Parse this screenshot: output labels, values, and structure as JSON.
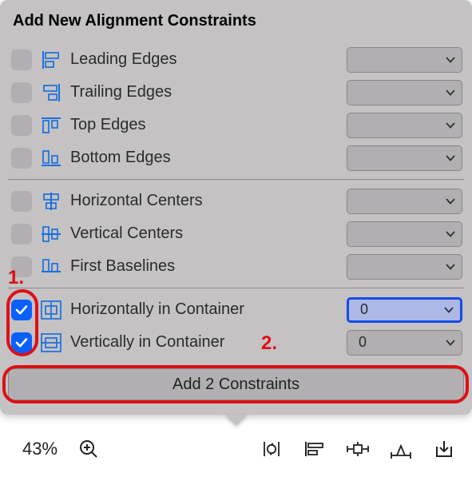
{
  "panelTitle": "Add New Alignment Constraints",
  "groups": [
    {
      "rows": [
        {
          "id": "leading",
          "checked": false,
          "iconKey": "align-leading",
          "label": "Leading Edges",
          "value": "",
          "highlighted": false
        },
        {
          "id": "trailing",
          "checked": false,
          "iconKey": "align-trailing",
          "label": "Trailing Edges",
          "value": "",
          "highlighted": false
        },
        {
          "id": "top",
          "checked": false,
          "iconKey": "align-top",
          "label": "Top Edges",
          "value": "",
          "highlighted": false
        },
        {
          "id": "bottom",
          "checked": false,
          "iconKey": "align-bottom",
          "label": "Bottom Edges",
          "value": "",
          "highlighted": false
        }
      ]
    },
    {
      "rows": [
        {
          "id": "hcenters",
          "checked": false,
          "iconKey": "align-hcenter",
          "label": "Horizontal Centers",
          "value": "",
          "highlighted": false
        },
        {
          "id": "vcenters",
          "checked": false,
          "iconKey": "align-vcenter",
          "label": "Vertical Centers",
          "value": "",
          "highlighted": false
        },
        {
          "id": "baselines",
          "checked": false,
          "iconKey": "align-baseline",
          "label": "First Baselines",
          "value": "",
          "highlighted": false
        }
      ]
    },
    {
      "rows": [
        {
          "id": "hcontainer",
          "checked": true,
          "iconKey": "align-h-in-container",
          "label": "Horizontally in Container",
          "value": "0",
          "highlighted": true
        },
        {
          "id": "vcontainer",
          "checked": true,
          "iconKey": "align-v-in-container",
          "label": "Vertically in Container",
          "value": "0",
          "highlighted": false
        }
      ]
    }
  ],
  "actionLabel": "Add 2 Constraints",
  "zoomLabel": "43%",
  "annotations": {
    "one": "1.",
    "two": "2."
  }
}
